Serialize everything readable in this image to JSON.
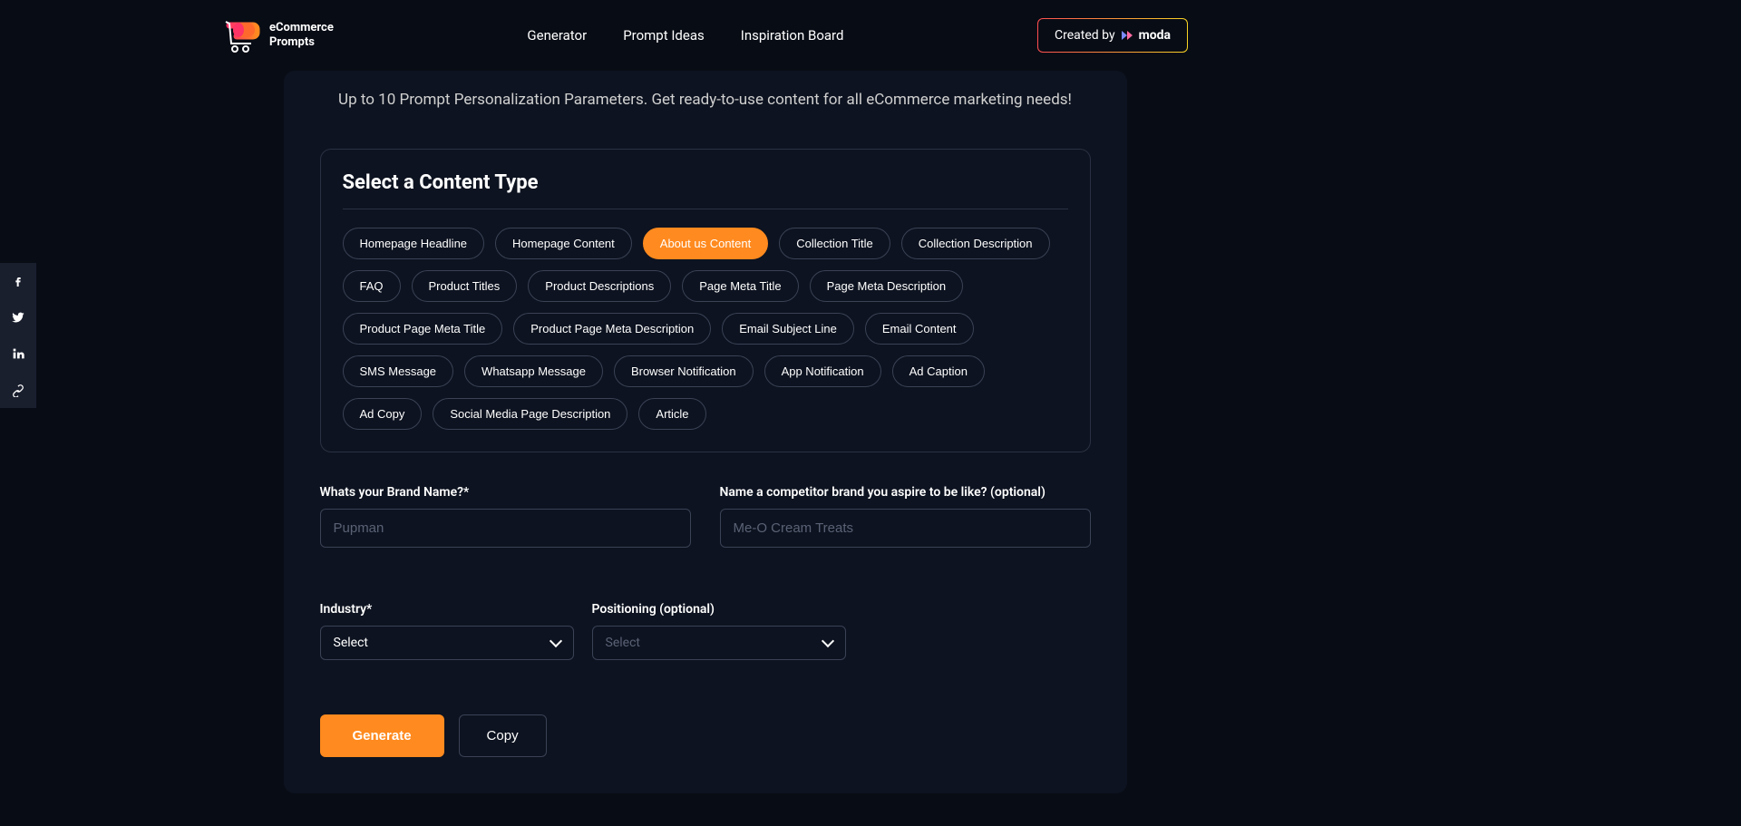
{
  "brand": {
    "line1": "eCommerce",
    "line2": "Prompts"
  },
  "nav": {
    "generator": "Generator",
    "promptIdeas": "Prompt Ideas",
    "inspiration": "Inspiration Board"
  },
  "createdBy": {
    "label": "Created by",
    "name": "moda"
  },
  "subtitle": "Up to 10 Prompt Personalization Parameters. Get ready-to-use content for all eCommerce marketing needs!",
  "contentType": {
    "title": "Select a Content Type",
    "chips": [
      "Homepage Headline",
      "Homepage Content",
      "About us Content",
      "Collection Title",
      "Collection Description",
      "FAQ",
      "Product Titles",
      "Product Descriptions",
      "Page Meta Title",
      "Page Meta Description",
      "Product Page Meta Title",
      "Product Page Meta Description",
      "Email Subject Line",
      "Email Content",
      "SMS Message",
      "Whatsapp Message",
      "Browser Notification",
      "App Notification",
      "Ad Caption",
      "Ad Copy",
      "Social Media Page Description",
      "Article"
    ],
    "activeIndex": 2
  },
  "form": {
    "brandName": {
      "label": "Whats your Brand Name?*",
      "placeholder": "Pupman"
    },
    "competitor": {
      "label": "Name a competitor brand you aspire to be like? (optional)",
      "placeholder": "Me-O Cream Treats"
    },
    "industry": {
      "label": "Industry*",
      "value": "Select"
    },
    "positioning": {
      "label": "Positioning (optional)",
      "value": "Select"
    }
  },
  "actions": {
    "generate": "Generate",
    "copy": "Copy"
  }
}
